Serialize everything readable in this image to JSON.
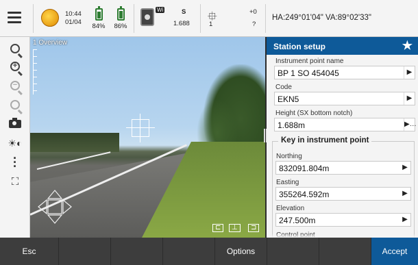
{
  "status": {
    "time": "10:44",
    "date": "01/04",
    "battery1": "84%",
    "battery1_level": 0.84,
    "battery2": "86%",
    "battery2_level": 0.86,
    "instrument_badge": "Wi",
    "instrument_face": "S",
    "instrument_height": "1.688",
    "target_index": "1",
    "prism_constant": "+0",
    "prism_unknown": "?",
    "angles": "HA:249°01'04\"  VA:89°02'33\""
  },
  "video": {
    "overview_label": "1 Overview"
  },
  "panel": {
    "title": "Station setup",
    "instrument_point_label": "Instrument point name",
    "instrument_point_value": "BP 1 SO 454045",
    "code_label": "Code",
    "code_value": "EKN5",
    "height_label": "Height (SX bottom notch)",
    "height_value": "1.688m",
    "group_title": "Key in instrument point",
    "northing_label": "Northing",
    "northing_value": "832091.804m",
    "easting_label": "Easting",
    "easting_value": "355264.592m",
    "elevation_label": "Elevation",
    "elevation_value": "247.500m",
    "control_point_label": "Control point"
  },
  "bottom": {
    "esc": "Esc",
    "options": "Options",
    "accept": "Accept"
  },
  "colors": {
    "accent": "#0e5a99",
    "battery": "#2e7d32"
  },
  "icons": [
    "menu-icon",
    "globe-icon",
    "battery-icon",
    "instrument-icon",
    "tripod-icon",
    "zoom-extents-icon",
    "zoom-in-icon",
    "zoom-out-icon",
    "zoom-previous-icon",
    "camera-icon",
    "brightness-icon",
    "more-icon",
    "measure-icon",
    "star-icon"
  ]
}
